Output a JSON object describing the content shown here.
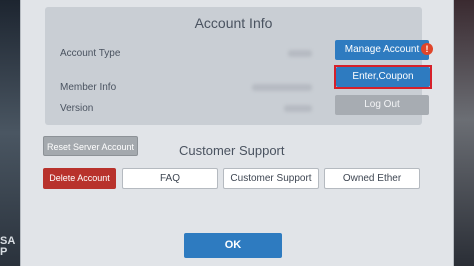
{
  "background": {
    "left_fragment_text": "SA\nP"
  },
  "account_info": {
    "title": "Account Info",
    "rows": [
      {
        "label": "Account Type"
      },
      {
        "label": "Member Info"
      },
      {
        "label": "Version"
      }
    ],
    "buttons": {
      "manage_account": "Manage Account",
      "manage_badge": "!",
      "enter_coupon": "Enter,Coupon",
      "log_out": "Log Out"
    }
  },
  "reset_server_account": "Reset Server Account",
  "customer_support": {
    "title": "Customer Support",
    "buttons": {
      "delete_account": "Delete Account",
      "faq": "FAQ",
      "customer_support": "Customer Support",
      "owned_ether": "Owned Ether"
    }
  },
  "ok_label": "OK",
  "colors": {
    "accent_blue": "#2e7bc0",
    "delete_red": "#b8322c",
    "highlight_red": "#d6202a",
    "disabled_gray": "#a7acb2"
  }
}
